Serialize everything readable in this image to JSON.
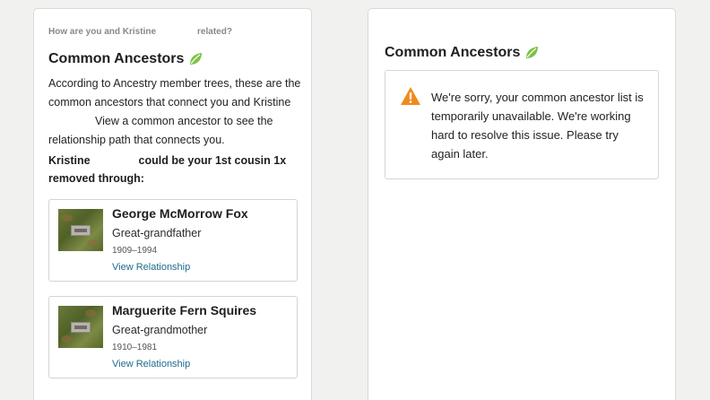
{
  "left_panel": {
    "question_part1": "How are you and Kristine",
    "question_part2": "related?",
    "heading": "Common Ancestors",
    "intro_part1": "According to Ancestry member trees, these are the common ancestors that connect you and Kristine",
    "intro_part2": "View a common ancestor to see the relationship path that connects you.",
    "cousin_part1": "Kristine",
    "cousin_part2": "could be your 1st cousin 1x removed through:",
    "ancestors": [
      {
        "name": "George McMorrow Fox",
        "relationship": "Great-grandfather",
        "dates": "1909–1994",
        "link": "View Relationship"
      },
      {
        "name": "Marguerite Fern Squires",
        "relationship": "Great-grandmother",
        "dates": "1910–1981",
        "link": "View Relationship"
      }
    ]
  },
  "right_panel": {
    "heading": "Common Ancestors",
    "error_message": "We're sorry, your common ancestor list is temporarily unavailable. We're working hard to resolve this issue. Please try again later."
  },
  "colors": {
    "background": "#f1f1f0",
    "leaf": "#7cc244",
    "warning": "#f08a1c",
    "link": "#1f6a8e"
  },
  "icons": {
    "leaf": "leaf-icon",
    "warning": "warning-triangle-icon"
  }
}
